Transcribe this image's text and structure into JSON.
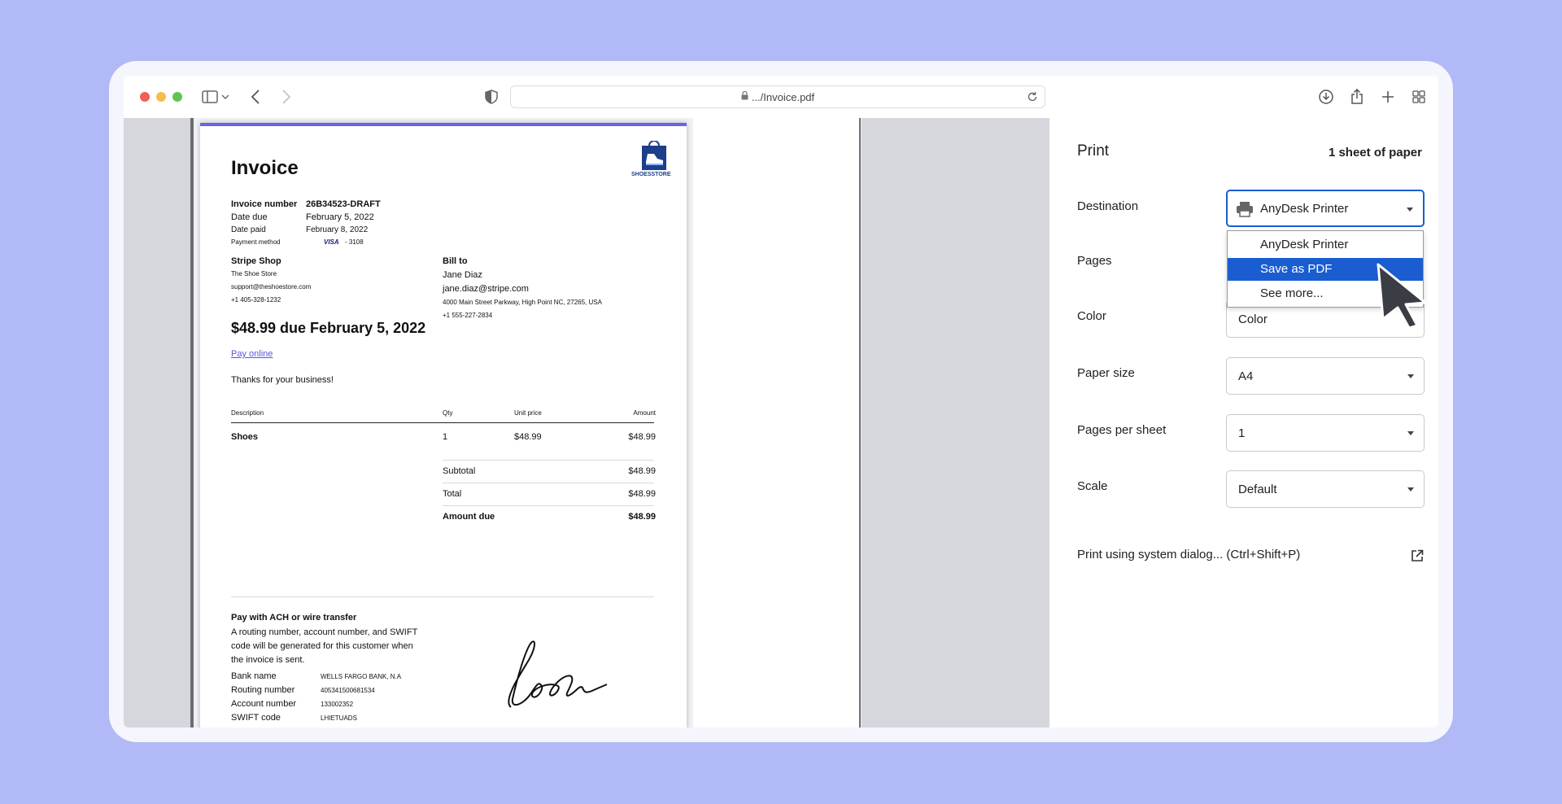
{
  "browser": {
    "url": ".../Invoice.pdf"
  },
  "invoice": {
    "title": "Invoice",
    "logo_text": "SHOESSTORE",
    "invoice_number_label": "Invoice number",
    "invoice_number": "26B34523-DRAFT",
    "date_due_label": "Date due",
    "date_due": "February 5, 2022",
    "date_paid_label": "Date paid",
    "date_paid": "February 8, 2022",
    "payment_method_label": "Payment method",
    "payment_card_brand": "VISA",
    "payment_card_last4": "- 3108",
    "seller": {
      "heading": "Stripe Shop",
      "name": "The Shoe Store",
      "email": "support@theshoestore.com",
      "phone": "+1 405-328-1232"
    },
    "bill_to": {
      "heading": "Bill to",
      "name": "Jane Diaz",
      "email": "jane.diaz@stripe.com",
      "address": "4000 Main Street Parkway, High Point NC, 27265, USA",
      "phone": "+1 555-227-2834"
    },
    "amount_due_headline": "$48.99 due February 5, 2022",
    "pay_online": "Pay online",
    "thanks": "Thanks for your business!",
    "table": {
      "headers": [
        "Description",
        "Qty",
        "Unit price",
        "Amount"
      ],
      "rows": [
        [
          "Shoes",
          "1",
          "$48.99",
          "$48.99"
        ]
      ]
    },
    "totals": {
      "subtotal_label": "Subtotal",
      "subtotal": "$48.99",
      "total_label": "Total",
      "total": "$48.99",
      "amount_due_label": "Amount due",
      "amount_due": "$48.99"
    },
    "ach": {
      "heading": "Pay with ACH or wire transfer",
      "line1": "A routing number, account number, and SWIFT",
      "line2": "code will be generated for this customer when",
      "line3": "the invoice is sent.",
      "bank_name_label": "Bank name",
      "bank_name": "WELLS FARGO BANK, N.A",
      "routing_label": "Routing number",
      "routing": "405341500681534",
      "account_label": "Account number",
      "account": "133002352",
      "swift_label": "SWIFT code",
      "swift": "LHIETUADS"
    }
  },
  "print": {
    "title": "Print",
    "sheet_count": "1 sheet of paper",
    "destination_label": "Destination",
    "destination_value": "AnyDesk Printer",
    "dropdown_options": [
      "AnyDesk Printer",
      "Save as PDF",
      "See more..."
    ],
    "dropdown_highlighted": "Save as PDF",
    "pages_label": "Pages",
    "color_label": "Color",
    "color_value": "Color",
    "paper_size_label": "Paper size",
    "paper_size_value": "A4",
    "pages_per_sheet_label": "Pages per sheet",
    "pages_per_sheet_value": "1",
    "scale_label": "Scale",
    "scale_value": "Default",
    "system_dialog": "Print using system dialog... (Ctrl+Shift+P)"
  },
  "colors": {
    "background": "#b1b9f6",
    "accent_blue": "#1a5dd1",
    "invoice_accent": "#6a63e8"
  },
  "icons": [
    "sidebar-icon",
    "chevron-down-icon",
    "back-icon",
    "forward-icon",
    "shield-icon",
    "lock-icon",
    "reload-icon",
    "download-icon",
    "share-icon",
    "new-tab-icon",
    "tab-overview-icon",
    "printer-icon",
    "open-external-icon",
    "mouse-cursor-icon"
  ]
}
